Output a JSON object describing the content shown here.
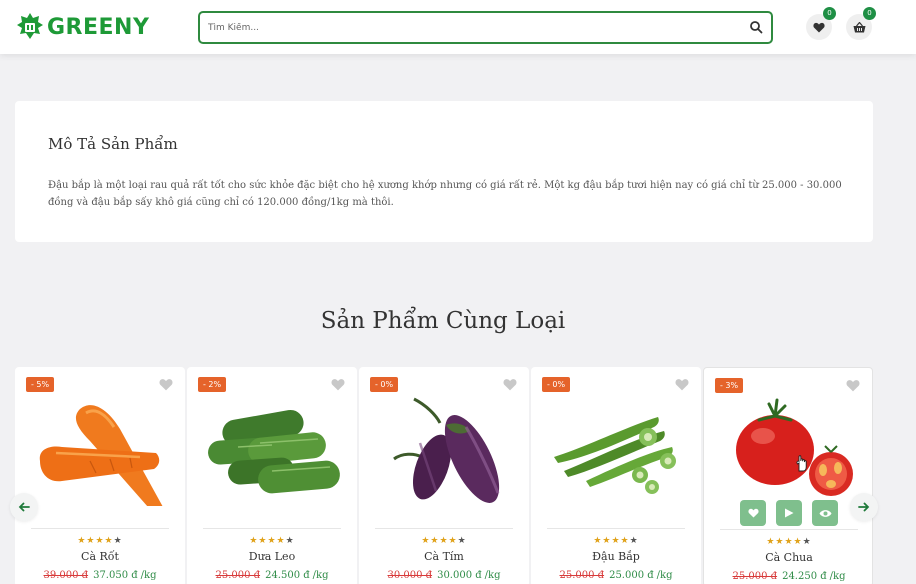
{
  "header": {
    "logo_text": "GREENY",
    "search_placeholder": "Tìm Kiếm...",
    "wishlist_count": "0",
    "cart_count": "0"
  },
  "description": {
    "title": "Mô Tả Sản Phẩm",
    "text": "Đậu bắp là một loại rau quả rất tốt cho sức khỏe đặc biệt cho hệ xương khớp nhưng có giá rất rẻ. Một kg đậu bắp tươi hiện nay có giá chỉ từ 25.000 - 30.000 đồng và đậu bắp sấy khô giá cũng chỉ có 120.000 đồng/1kg mà thôi."
  },
  "related": {
    "title": "Sản Phẩm Cùng Loại",
    "products": [
      {
        "discount": "- 5%",
        "name": "Cà Rốt",
        "old_price": "39.000 đ",
        "price": "37.050 đ",
        "unit": "/kg",
        "rating": 4
      },
      {
        "discount": "- 2%",
        "name": "Dưa Leo",
        "old_price": "25.000 đ",
        "price": "24.500 đ",
        "unit": "/kg",
        "rating": 4
      },
      {
        "discount": "- 0%",
        "name": "Cà Tím",
        "old_price": "30.000 đ",
        "price": "30.000 đ",
        "unit": "/kg",
        "rating": 4
      },
      {
        "discount": "- 0%",
        "name": "Đậu Bắp",
        "old_price": "25.000 đ",
        "price": "25.000 đ",
        "unit": "/kg",
        "rating": 4
      },
      {
        "discount": "- 3%",
        "name": "Cà Chua",
        "old_price": "25.000 đ",
        "price": "24.250 đ",
        "unit": "/kg",
        "rating": 4
      }
    ]
  },
  "colors": {
    "brand": "#1e9a37",
    "discount": "#e5632a",
    "old_price": "#d83b3b",
    "new_price": "#2e8b46",
    "star": "#e0a21a"
  },
  "icons": [
    "logo-leaf-icon",
    "search-icon",
    "heart-icon",
    "basket-icon",
    "play-icon",
    "eye-icon",
    "arrow-left-icon",
    "arrow-right-icon"
  ]
}
